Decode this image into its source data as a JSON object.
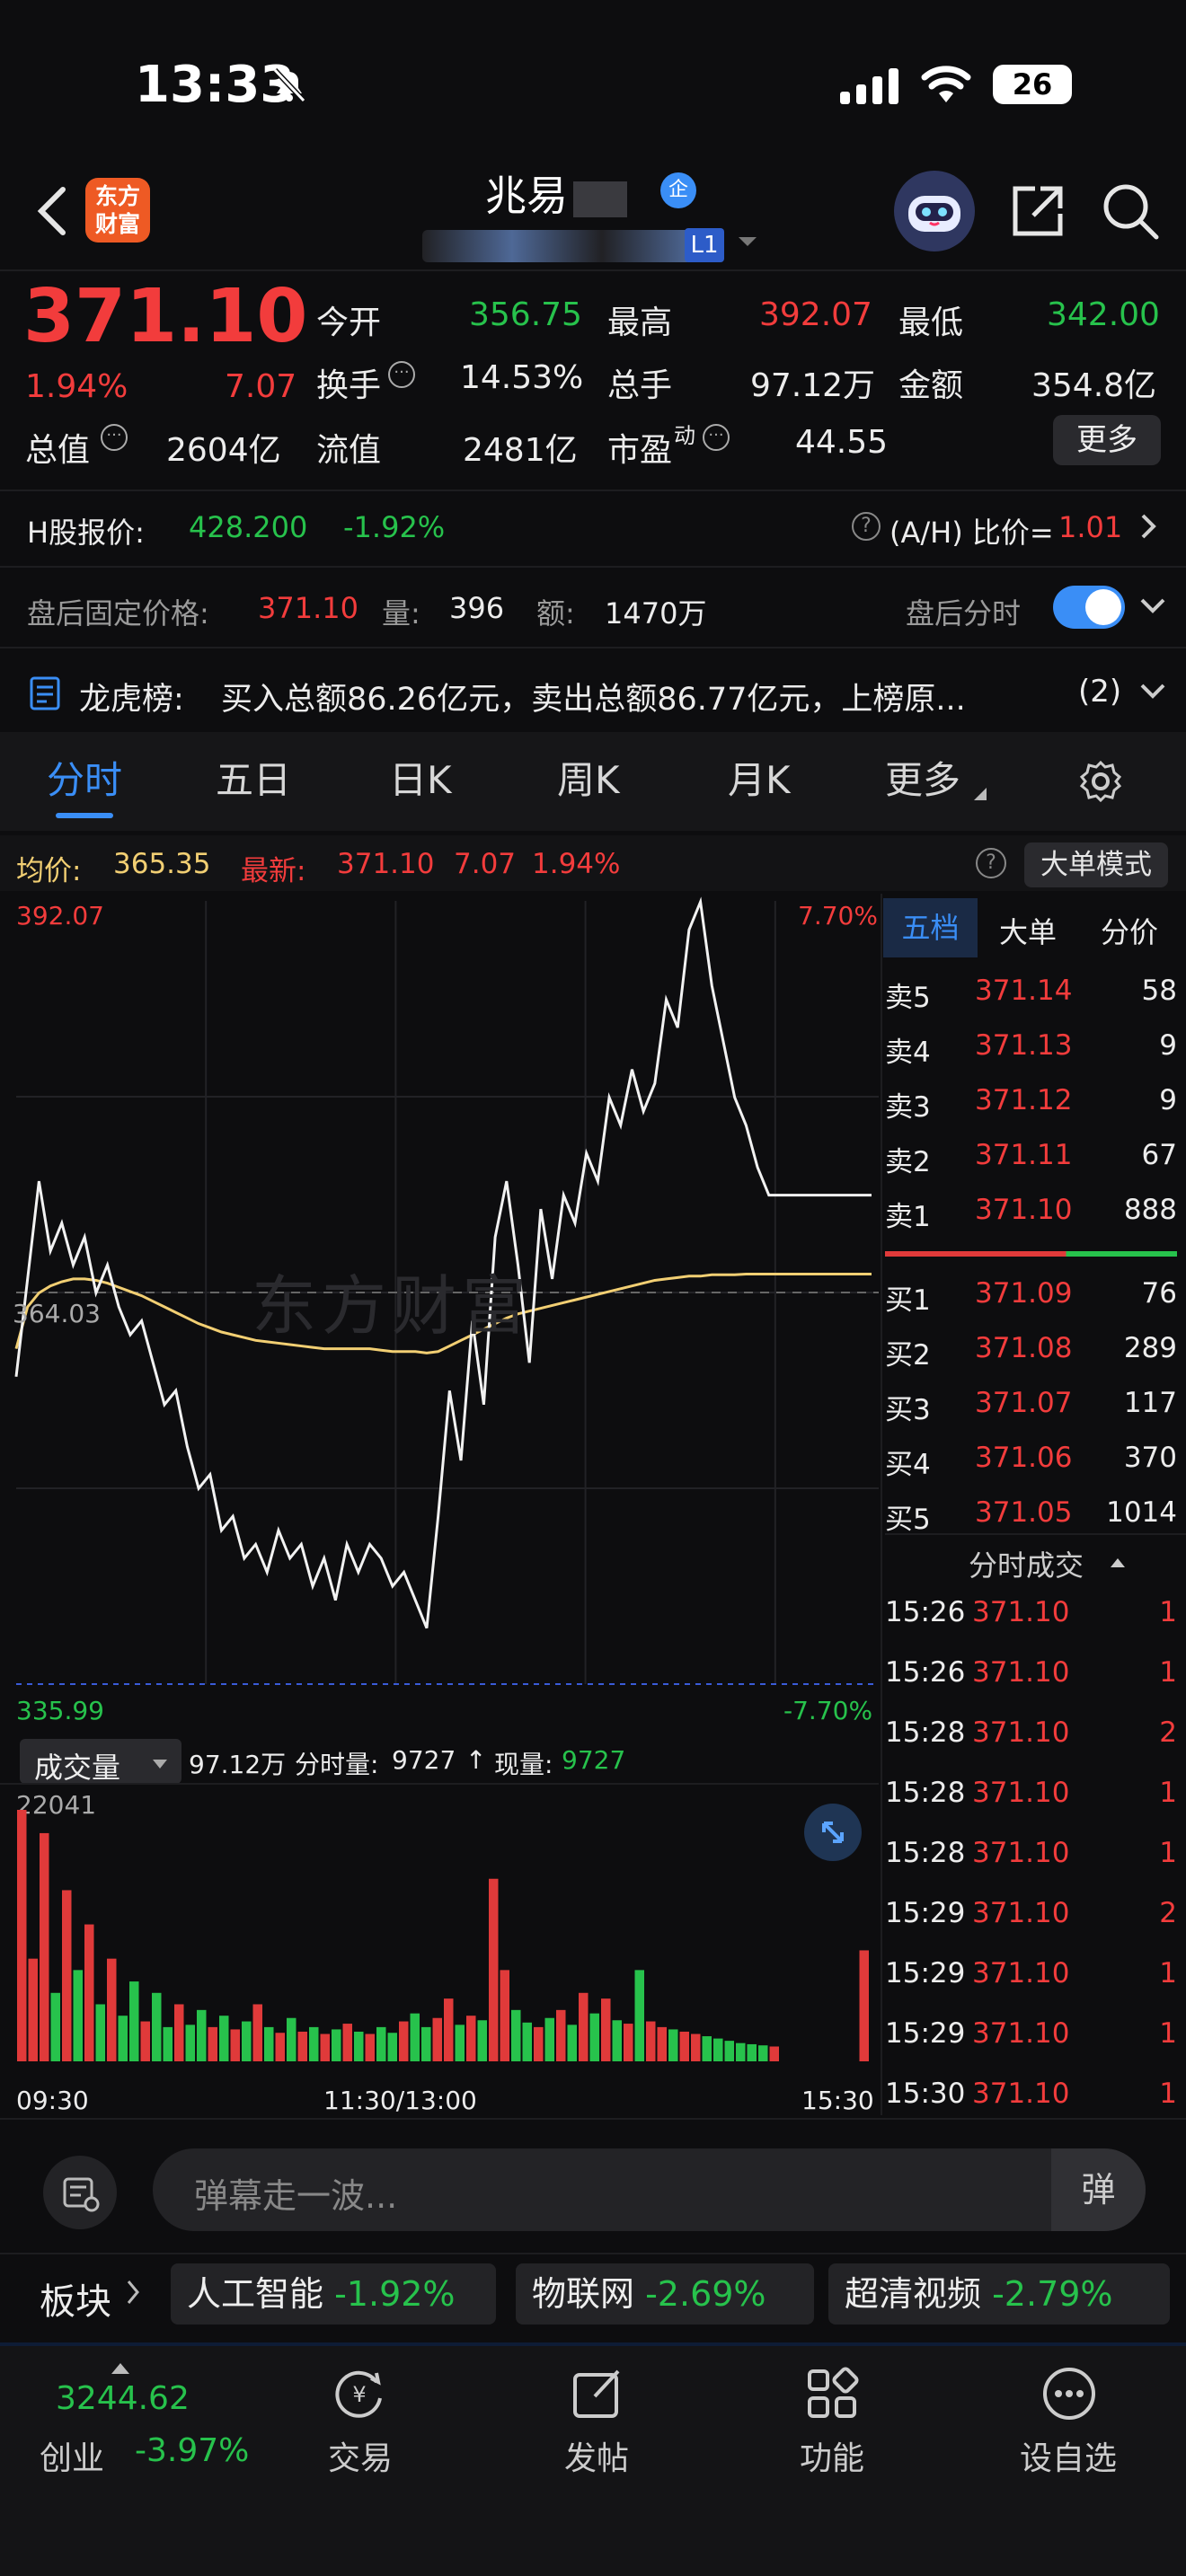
{
  "status_bar": {
    "time": "13:33",
    "battery": "26"
  },
  "header": {
    "title": "兆易",
    "level_badge": "L1",
    "brand_line1": "东方",
    "brand_line2": "财富"
  },
  "quote": {
    "price": "371.10",
    "change_pct": "1.94%",
    "change": "7.07",
    "open_label": "今开",
    "open": "356.75",
    "high_label": "最高",
    "high": "392.07",
    "low_label": "最低",
    "low": "342.00",
    "turnover_label": "换手",
    "turnover": "14.53%",
    "volume_label": "总手",
    "volume": "97.12万",
    "amount_label": "金额",
    "amount": "354.8亿",
    "mktcap_label": "总值",
    "mktcap": "2604亿",
    "float_label": "流值",
    "float": "2481亿",
    "pe_label": "市盈",
    "pe_sup": "动",
    "pe": "44.55",
    "more": "更多"
  },
  "hshare": {
    "label": "H股报价:",
    "price": "428.200",
    "pct": "-1.92%",
    "ratio_label": "(A/H) 比价=",
    "ratio": "1.01"
  },
  "after_hours": {
    "label": "盘后固定价格:",
    "price": "371.10",
    "vol_label": "量:",
    "vol": "396",
    "amt_label": "额:",
    "amt": "1470万",
    "toggle_label": "盘后分时"
  },
  "dragon": {
    "label": "龙虎榜:",
    "text": "买入总额86.26亿元，卖出总额86.77亿元，上榜原...",
    "count": "(2)"
  },
  "tabs": [
    "分时",
    "五日",
    "日K",
    "周K",
    "月K",
    "更多"
  ],
  "chart_header": {
    "avg_label": "均价:",
    "avg": "365.35",
    "latest_label": "最新:",
    "latest": "371.10",
    "chg": "7.07",
    "pct": "1.94%",
    "mode": "大单模式"
  },
  "chart_data": {
    "type": "line",
    "ylim": [
      335.99,
      392.07
    ],
    "y_top_label": "392.07",
    "y_bottom_label": "335.99",
    "y_mid_label": "364.03",
    "pct_top": "7.70%",
    "pct_bottom": "-7.70%",
    "x_labels": [
      "09:30",
      "11:30/13:00",
      "15:30"
    ],
    "price_series": [
      358,
      365,
      372,
      367,
      369,
      366,
      368,
      364,
      366,
      363,
      361,
      362,
      359,
      356,
      357,
      353,
      350,
      351,
      347,
      348,
      345,
      346,
      344,
      347,
      345,
      346,
      343,
      345,
      342,
      346,
      344,
      346,
      345,
      343,
      344,
      342,
      340,
      348,
      357,
      352,
      362,
      356,
      368,
      372,
      366,
      359,
      370,
      365,
      371,
      369,
      374,
      372,
      378,
      376,
      380,
      377,
      379,
      385,
      383,
      390,
      392,
      386,
      382,
      378,
      376,
      373,
      371,
      371,
      371,
      371,
      371,
      371,
      371,
      371,
      371,
      371
    ],
    "avg_series": [
      360,
      363,
      364,
      364.5,
      364.8,
      365,
      365,
      364.9,
      364.7,
      364.4,
      364.1,
      363.8,
      363.4,
      363,
      362.6,
      362.2,
      361.8,
      361.5,
      361.2,
      361,
      360.8,
      360.6,
      360.5,
      360.4,
      360.3,
      360.2,
      360.1,
      360,
      360,
      360,
      360,
      360,
      359.9,
      359.8,
      359.8,
      359.8,
      359.7,
      359.8,
      360.2,
      360.6,
      361,
      361.4,
      361.8,
      362.2,
      362.5,
      362.7,
      362.9,
      363.1,
      363.3,
      363.5,
      363.7,
      363.9,
      364.1,
      364.3,
      364.5,
      364.7,
      364.9,
      365,
      365.1,
      365.2,
      365.2,
      365.3,
      365.3,
      365.3,
      365.35,
      365.35,
      365.35,
      365.35,
      365.35,
      365.35,
      365.35,
      365.35,
      365.35,
      365.35,
      365.35,
      365.35
    ],
    "volume_label": "成交量",
    "volume_total": "97.12万",
    "bar_vol_label": "分时量:",
    "bar_vol": "9727",
    "now_vol_label": "现量:",
    "now_vol": "9727",
    "vol_max_label": "22041",
    "volume_series": [
      22041,
      9000,
      20000,
      6000,
      15000,
      8000,
      12000,
      5000,
      9000,
      4000,
      7000,
      3500,
      6000,
      3000,
      5000,
      3200,
      4500,
      3000,
      4000,
      2800,
      3500,
      5000,
      3000,
      2500,
      3800,
      2600,
      3000,
      2400,
      2800,
      3300,
      2600,
      2400,
      3000,
      2500,
      3500,
      4200,
      3000,
      3800,
      5500,
      3200,
      4000,
      3600,
      16000,
      8000,
      4500,
      3400,
      3000,
      3800,
      4500,
      3200,
      6000,
      4200,
      5500,
      3600,
      3300,
      8000,
      3500,
      3000,
      2800,
      2600,
      2400,
      2200,
      2000,
      1800,
      1600,
      1500,
      1400,
      1300,
      0,
      0,
      0,
      0,
      0,
      0,
      0,
      9727
    ]
  },
  "orderbook": {
    "tabs": [
      "五档",
      "大单",
      "分价"
    ],
    "asks": [
      {
        "l": "卖5",
        "p": "371.14",
        "v": "58"
      },
      {
        "l": "卖4",
        "p": "371.13",
        "v": "9"
      },
      {
        "l": "卖3",
        "p": "371.12",
        "v": "9"
      },
      {
        "l": "卖2",
        "p": "371.11",
        "v": "67"
      },
      {
        "l": "卖1",
        "p": "371.10",
        "v": "888"
      }
    ],
    "bids": [
      {
        "l": "买1",
        "p": "371.09",
        "v": "76"
      },
      {
        "l": "买2",
        "p": "371.08",
        "v": "289"
      },
      {
        "l": "买3",
        "p": "371.07",
        "v": "117"
      },
      {
        "l": "买4",
        "p": "371.06",
        "v": "370"
      },
      {
        "l": "买5",
        "p": "371.05",
        "v": "1014"
      }
    ],
    "ticks_label": "分时成交",
    "ticks": [
      {
        "t": "15:26",
        "p": "371.10",
        "v": "1"
      },
      {
        "t": "15:26",
        "p": "371.10",
        "v": "1"
      },
      {
        "t": "15:28",
        "p": "371.10",
        "v": "2"
      },
      {
        "t": "15:28",
        "p": "371.10",
        "v": "1"
      },
      {
        "t": "15:28",
        "p": "371.10",
        "v": "1"
      },
      {
        "t": "15:29",
        "p": "371.10",
        "v": "2"
      },
      {
        "t": "15:29",
        "p": "371.10",
        "v": "1"
      },
      {
        "t": "15:29",
        "p": "371.10",
        "v": "1"
      },
      {
        "t": "15:30",
        "p": "371.10",
        "v": "1"
      }
    ]
  },
  "comment": {
    "placeholder": "弹幕走一波...",
    "danmu": "弹"
  },
  "sectors": {
    "label": "板块",
    "items": [
      {
        "n": "人工智能",
        "p": "-1.92%"
      },
      {
        "n": "物联网",
        "p": "-2.69%"
      },
      {
        "n": "超清视频",
        "p": "-2.79%"
      }
    ]
  },
  "bottom_nav": {
    "index_value": "3244.62",
    "index_name": "创业",
    "index_pct": "-3.97%",
    "items": [
      "交易",
      "发帖",
      "功能",
      "设自选"
    ]
  }
}
